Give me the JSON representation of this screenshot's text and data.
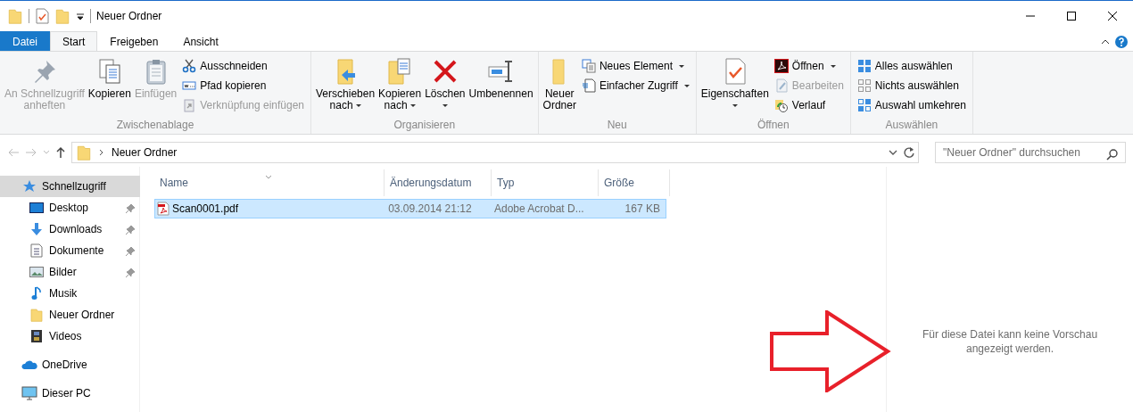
{
  "window": {
    "title": "Neuer Ordner"
  },
  "ribbon_tabs": [
    {
      "label": "Datei",
      "kind": "file",
      "selected": false
    },
    {
      "label": "Start",
      "kind": "tab",
      "selected": true
    },
    {
      "label": "Freigeben",
      "kind": "tab",
      "selected": false
    },
    {
      "label": "Ansicht",
      "kind": "tab",
      "selected": false
    }
  ],
  "ribbon_groups": [
    {
      "label": "Zwischenablage",
      "items": [
        {
          "kind": "large",
          "label": "An Schnellzugriff\nanheften",
          "disabled": true,
          "dropdown": false
        },
        {
          "kind": "large",
          "label": "Kopieren",
          "disabled": false,
          "dropdown": false
        },
        {
          "kind": "large",
          "label": "Einfügen",
          "disabled": true,
          "dropdown": false
        },
        {
          "kind": "small",
          "label": "Ausschneiden",
          "disabled": false,
          "dropdown": false
        },
        {
          "kind": "small",
          "label": "Pfad kopieren",
          "disabled": false,
          "dropdown": false
        },
        {
          "kind": "small",
          "label": "Verknüpfung einfügen",
          "disabled": true,
          "dropdown": false
        }
      ]
    },
    {
      "label": "Organisieren",
      "items": [
        {
          "kind": "large",
          "label": "Verschieben\nnach",
          "disabled": false,
          "dropdown": true
        },
        {
          "kind": "large",
          "label": "Kopieren\nnach",
          "disabled": false,
          "dropdown": true
        },
        {
          "kind": "large",
          "label": "Löschen",
          "disabled": false,
          "dropdown": true
        },
        {
          "kind": "large",
          "label": "Umbenennen",
          "disabled": false,
          "dropdown": false
        }
      ]
    },
    {
      "label": "Neu",
      "items": [
        {
          "kind": "large",
          "label": "Neuer\nOrdner",
          "disabled": false,
          "dropdown": false
        },
        {
          "kind": "small",
          "label": "Neues Element",
          "disabled": false,
          "dropdown": true
        },
        {
          "kind": "small",
          "label": "Einfacher Zugriff",
          "disabled": false,
          "dropdown": true
        }
      ]
    },
    {
      "label": "Öffnen",
      "items": [
        {
          "kind": "large",
          "label": "Eigenschaften",
          "disabled": false,
          "dropdown": true
        },
        {
          "kind": "small",
          "label": "Öffnen",
          "disabled": false,
          "dropdown": true
        },
        {
          "kind": "small",
          "label": "Bearbeiten",
          "disabled": true,
          "dropdown": false
        },
        {
          "kind": "small",
          "label": "Verlauf",
          "disabled": false,
          "dropdown": false
        }
      ]
    },
    {
      "label": "Auswählen",
      "items": [
        {
          "kind": "small",
          "label": "Alles auswählen",
          "disabled": false,
          "dropdown": false
        },
        {
          "kind": "small",
          "label": "Nichts auswählen",
          "disabled": false,
          "dropdown": false
        },
        {
          "kind": "small",
          "label": "Auswahl umkehren",
          "disabled": false,
          "dropdown": false
        }
      ]
    }
  ],
  "address_bar": {
    "path": "Neuer Ordner"
  },
  "search": {
    "placeholder": "\"Neuer Ordner\" durchsuchen"
  },
  "sidebar": {
    "items": [
      {
        "label": "Schnellzugriff",
        "selected": true,
        "pinned": false,
        "children": [
          {
            "label": "Desktop",
            "selected": false,
            "pinned": true
          },
          {
            "label": "Downloads",
            "selected": false,
            "pinned": true
          },
          {
            "label": "Dokumente",
            "selected": false,
            "pinned": true
          },
          {
            "label": "Bilder",
            "selected": false,
            "pinned": true
          },
          {
            "label": "Musik",
            "selected": false,
            "pinned": false
          },
          {
            "label": "Neuer Ordner",
            "selected": false,
            "pinned": false
          },
          {
            "label": "Videos",
            "selected": false,
            "pinned": false
          }
        ]
      },
      {
        "label": "OneDrive",
        "selected": false,
        "pinned": false
      },
      {
        "label": "Dieser PC",
        "selected": false,
        "pinned": false
      }
    ]
  },
  "table": {
    "columns": [
      "Name",
      "Änderungsdatum",
      "Typ",
      "Größe"
    ],
    "rows": [
      {
        "cells": [
          "Scan0001.pdf",
          "03.09.2014 21:12",
          "Adobe Acrobat D...",
          "167 KB"
        ],
        "selected": true
      }
    ]
  },
  "preview": {
    "message": "Für diese Datei kann keine Vorschau angezeigt werden."
  }
}
